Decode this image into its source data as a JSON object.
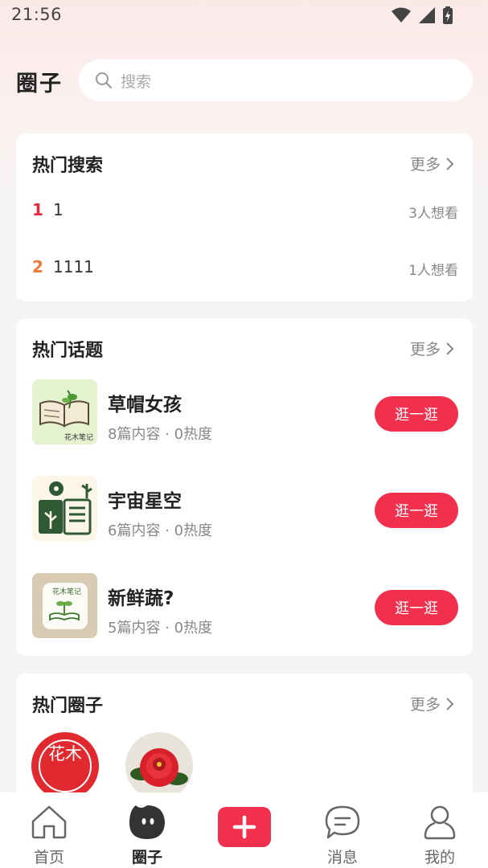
{
  "status_bar": {
    "time": "21:56"
  },
  "header": {
    "title": "圈子",
    "search_placeholder": "搜索"
  },
  "hot_search": {
    "title": "热门搜索",
    "more": "更多",
    "items": [
      {
        "rank": "1",
        "term": "1",
        "want": "3人想看",
        "rank_color": "#e8283c"
      },
      {
        "rank": "2",
        "term": "1111",
        "want": "1人想看",
        "rank_color": "#f0773a"
      }
    ]
  },
  "hot_topics": {
    "title": "热门话题",
    "more": "更多",
    "items": [
      {
        "name": "草帽女孩",
        "meta": "8篇内容 · 0热度",
        "action": "逛一逛",
        "thumb_text": "花木笔记"
      },
      {
        "name": "宇宙星空",
        "meta": "6篇内容 · 0热度",
        "action": "逛一逛"
      },
      {
        "name": "新鲜蔬?",
        "meta": "5篇内容 · 0热度",
        "action": "逛一逛",
        "thumb_text": "花木笔记"
      }
    ]
  },
  "hot_circles": {
    "title": "热门圈子",
    "more": "更多",
    "logo_text": "花木"
  },
  "bottom_nav": {
    "items": [
      {
        "label": "首页",
        "icon": "home-icon"
      },
      {
        "label": "圈子",
        "icon": "circle-icon",
        "active": true
      },
      {
        "label": "",
        "icon": "add-icon"
      },
      {
        "label": "消息",
        "icon": "message-icon"
      },
      {
        "label": "我的",
        "icon": "profile-icon"
      }
    ]
  },
  "colors": {
    "accent": "#f0304c"
  }
}
